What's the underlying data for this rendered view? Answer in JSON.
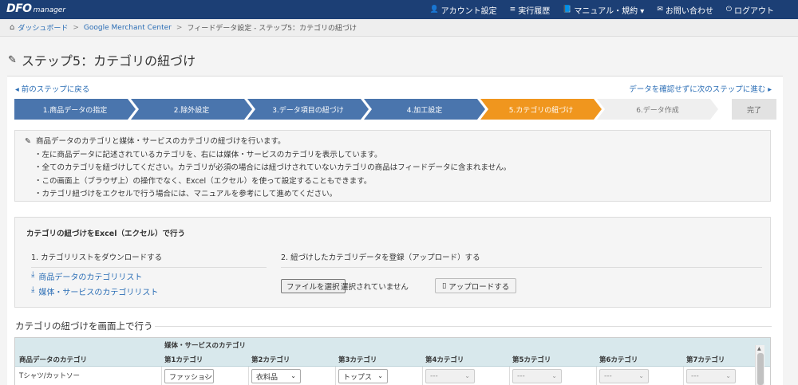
{
  "app": {
    "logo_mark": "DFO",
    "logo_sub": "manager"
  },
  "nav": [
    {
      "icon": "user-icon",
      "glyph": "👤",
      "label": "アカウント設定"
    },
    {
      "icon": "list-icon",
      "glyph": "≡",
      "label": "実行履歴"
    },
    {
      "icon": "book-icon",
      "glyph": "📘",
      "label": "マニュアル・規約 ▾"
    },
    {
      "icon": "mail-icon",
      "glyph": "✉",
      "label": "お問い合わせ"
    },
    {
      "icon": "power-icon",
      "glyph": "⏻",
      "label": "ログアウト"
    }
  ],
  "breadcrumb": {
    "home": "ダッシュボード",
    "merchant": "Google Merchant Center",
    "current": "フィードデータ設定 - ステップ5：カテゴリの紐づけ"
  },
  "page": {
    "title": "ステップ5：カテゴリの紐づけ"
  },
  "stepnav": {
    "back": "◂ 前のステップに戻る",
    "skip": "データを確認せずに次のステップに進む ▸"
  },
  "steps": [
    {
      "label": "1.商品データの指定",
      "state": "done"
    },
    {
      "label": "2.除外設定",
      "state": "done"
    },
    {
      "label": "3.データ項目の紐づけ",
      "state": "done"
    },
    {
      "label": "4.加工設定",
      "state": "done"
    },
    {
      "label": "5.カテゴリの紐づけ",
      "state": "active"
    },
    {
      "label": "6.データ作成",
      "state": "todo"
    },
    {
      "label": "完了",
      "state": "end"
    }
  ],
  "info": {
    "lead": "商品データのカテゴリと媒体・サービスのカテゴリの紐づけを行います。",
    "bullets": [
      "・左に商品データに記述されているカテゴリを、右には媒体・サービスのカテゴリを表示しています。",
      "・全てのカテゴリを紐づけしてください。カテゴリが必須の場合には紐づけされていないカテゴリの商品はフィードデータに含まれません。",
      "・この画面上（ブラウザ上）の操作でなく、Excel（エクセル）を使って設定することもできます。",
      "・カテゴリ紐づけをエクセルで行う場合には、マニュアルを参考にして進めてください。"
    ]
  },
  "excel": {
    "title": "カテゴリの紐づけをExcel（エクセル）で行う",
    "download_head": "1. カテゴリリストをダウンロードする",
    "download_links": [
      "商品データのカテゴリリスト",
      "媒体・サービスのカテゴリリスト"
    ],
    "upload_head": "2. 紐づけしたカテゴリデータを登録（アップロード）する",
    "file_button": "ファイルを選択",
    "no_file": "選択されていません",
    "upload_button": "アップロードする"
  },
  "onscreen": {
    "title": "カテゴリの紐づけを画面上で行う",
    "group_header": "媒体・サービスのカテゴリ",
    "product_col": "商品データのカテゴリ",
    "cat_cols": [
      "第1カテゴリ",
      "第2カテゴリ",
      "第3カテゴリ",
      "第4カテゴリ",
      "第5カテゴリ",
      "第6カテゴリ",
      "第7カテゴリ"
    ],
    "rows": [
      {
        "product": "Tシャツ/カットソー",
        "values": [
          "ファッション",
          "衣料品",
          "トップス",
          "---",
          "---",
          "---",
          "---"
        ]
      }
    ]
  }
}
